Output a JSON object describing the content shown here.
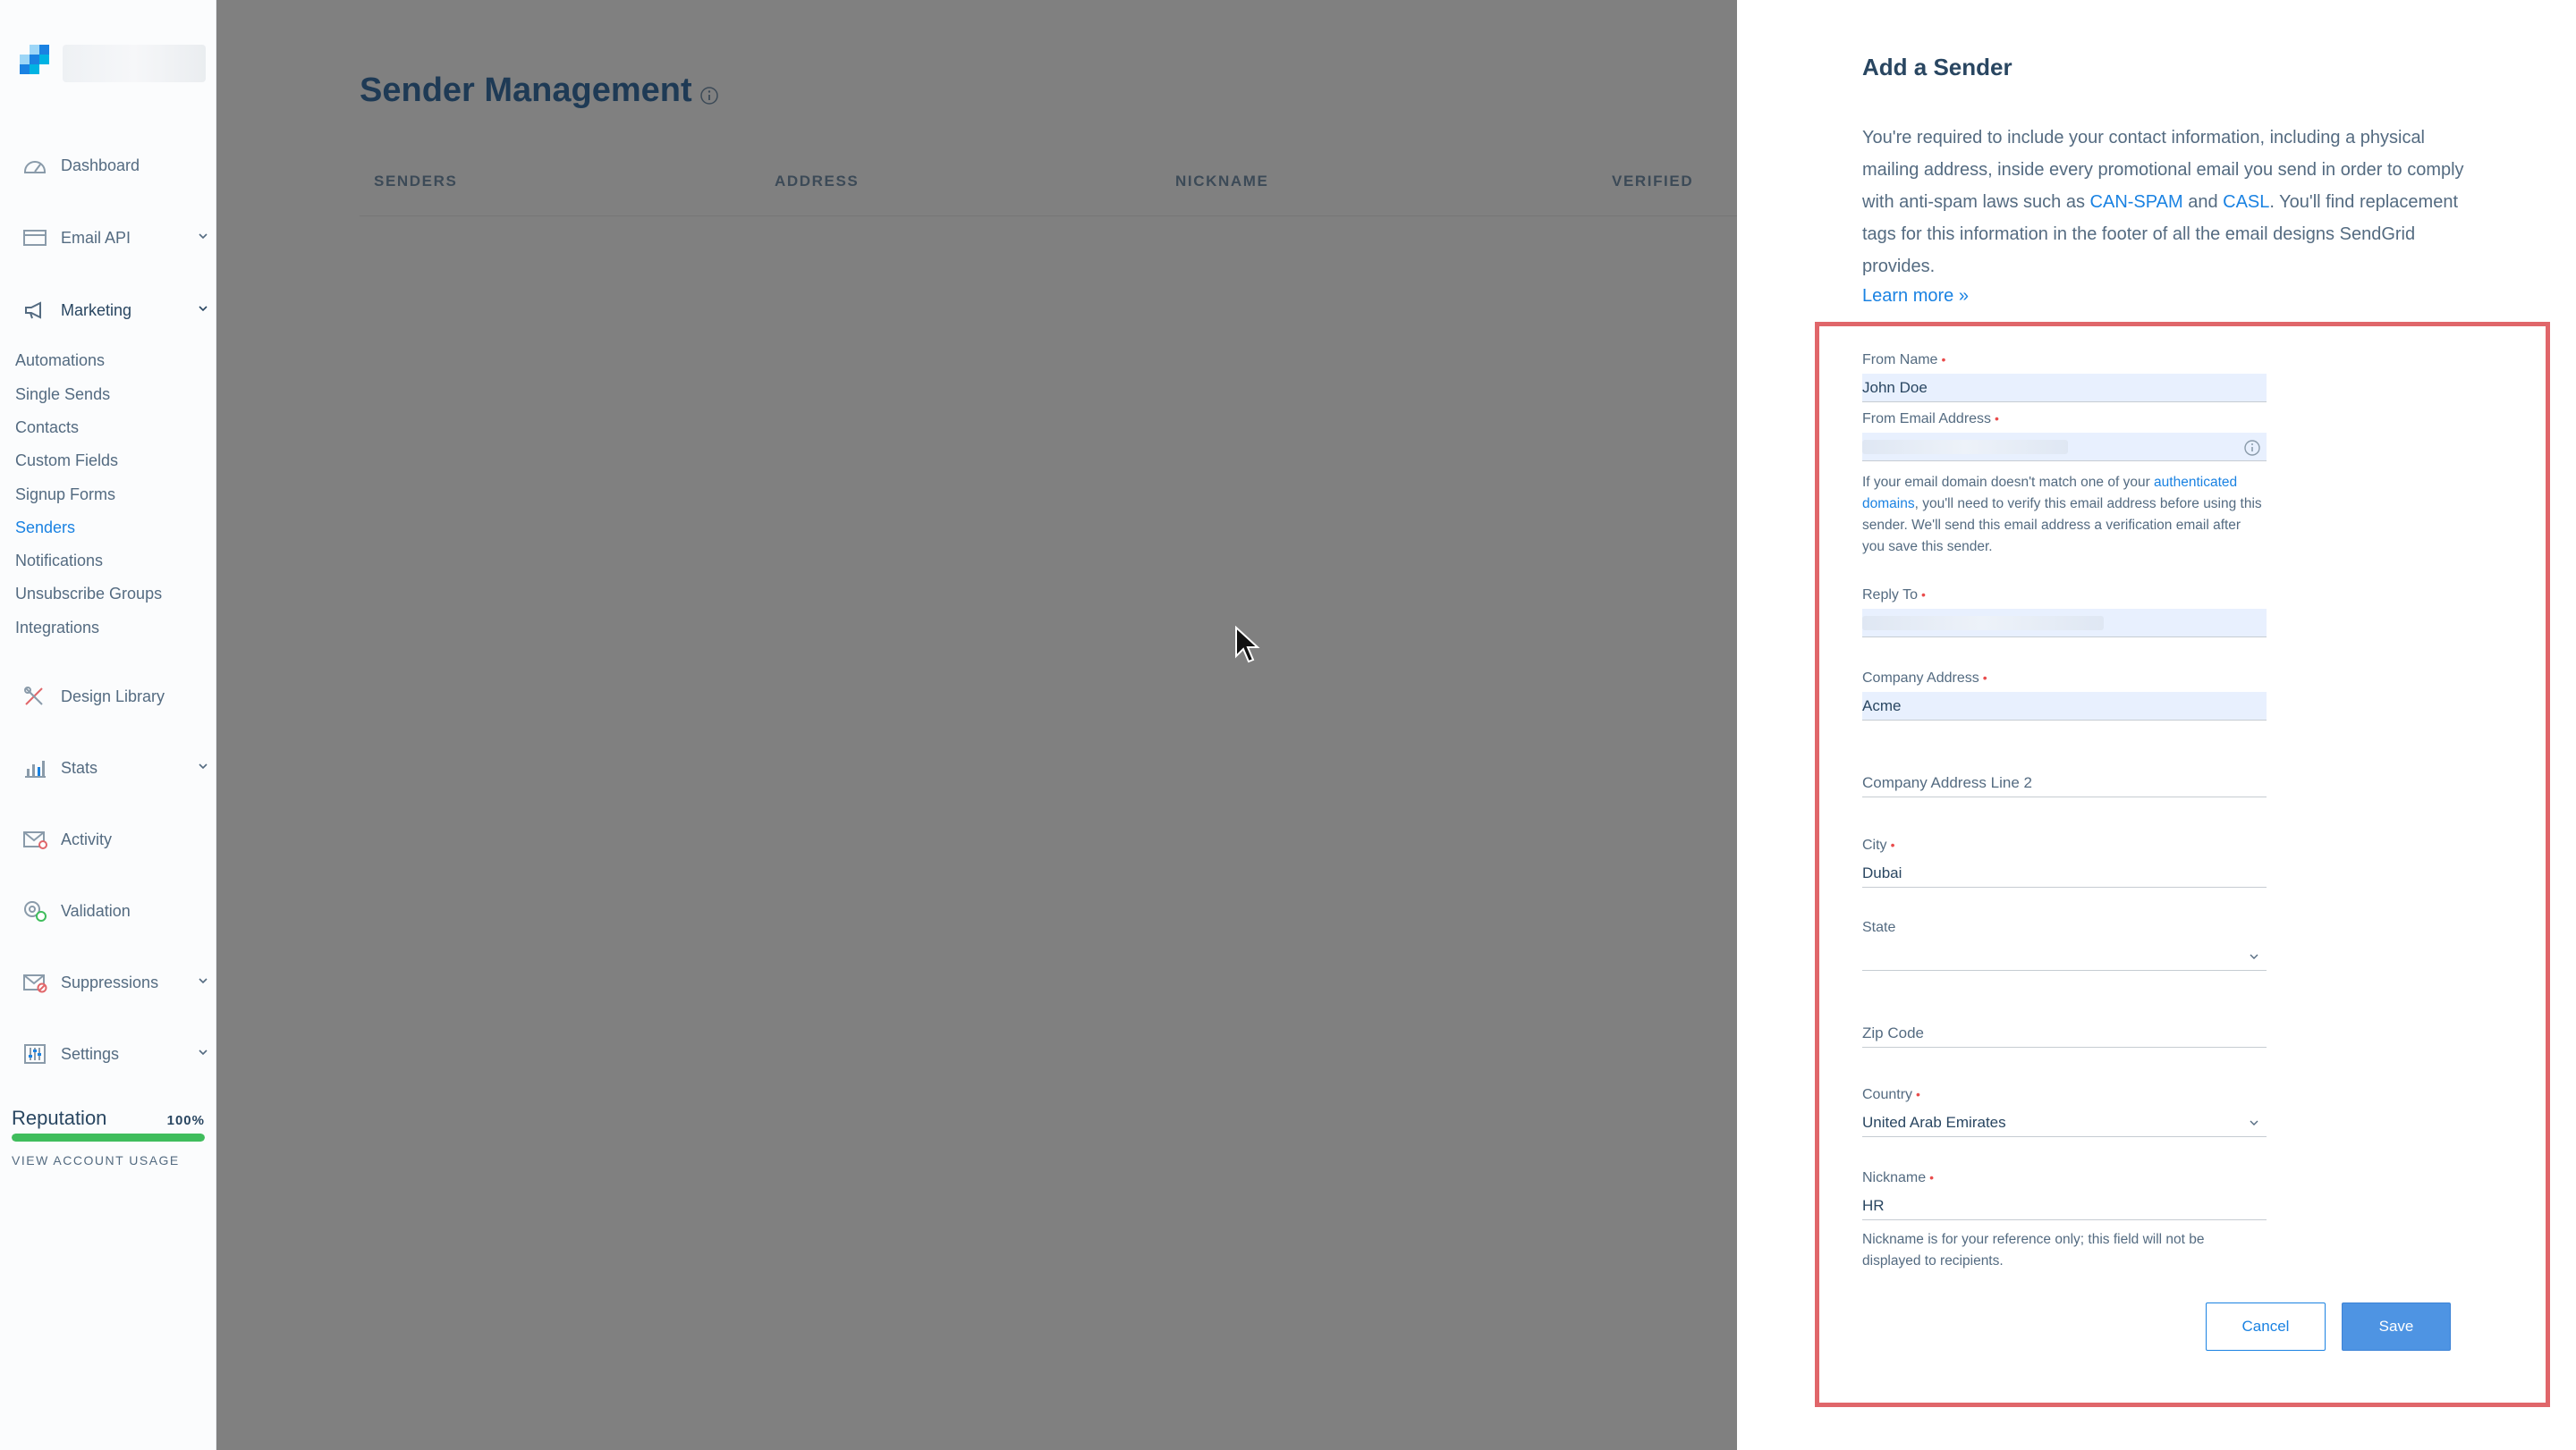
{
  "sidebar": {
    "items": [
      {
        "label": "Dashboard",
        "icon": "dashboard-icon"
      },
      {
        "label": "Email API",
        "icon": "email-api-icon"
      },
      {
        "label": "Marketing",
        "icon": "megaphone-icon"
      },
      {
        "label": "Design Library",
        "icon": "design-library-icon"
      },
      {
        "label": "Stats",
        "icon": "stats-icon"
      },
      {
        "label": "Activity",
        "icon": "activity-icon"
      },
      {
        "label": "Validation",
        "icon": "validation-icon"
      },
      {
        "label": "Suppressions",
        "icon": "suppressions-icon"
      },
      {
        "label": "Settings",
        "icon": "settings-icon"
      }
    ],
    "marketing_sub": [
      "Automations",
      "Single Sends",
      "Contacts",
      "Custom Fields",
      "Signup Forms",
      "Senders",
      "Notifications",
      "Unsubscribe Groups",
      "Integrations"
    ],
    "selected_sub": "Senders",
    "reputation_label": "Reputation",
    "reputation_value": "100%",
    "reputation_fraction": 1.0,
    "account_usage": "VIEW ACCOUNT USAGE"
  },
  "main": {
    "title": "Sender Management",
    "columns": [
      "SENDERS",
      "ADDRESS",
      "NICKNAME",
      "VERIFIED"
    ]
  },
  "panel": {
    "title": "Add a Sender",
    "intro_1": "You're required to include your contact information, including a physical mailing address, inside every promotional email you send in order to comply with anti-spam laws such as ",
    "link_canspam": "CAN-SPAM",
    "intro_and": " and ",
    "link_casl": "CASL",
    "intro_2": ". You'll find replacement tags for this information in the footer of all the email designs SendGrid provides.",
    "learn_more": "Learn more »",
    "fields": {
      "from_name": {
        "label": "From Name",
        "value": "John Doe"
      },
      "from_email": {
        "label": "From Email Address",
        "value": ""
      },
      "from_email_help_1": "If your email domain doesn't match one of your ",
      "from_email_help_link": "authenticated domains",
      "from_email_help_2": ", you'll need to verify this email address before using this sender. We'll send this email address a verification email after you save this sender.",
      "reply_to": {
        "label": "Reply To",
        "value": ""
      },
      "company_address": {
        "label": "Company Address",
        "value": "Acme"
      },
      "company_address_2": {
        "label": "Company Address Line 2",
        "value": ""
      },
      "city": {
        "label": "City",
        "value": "Dubai"
      },
      "state": {
        "label": "State",
        "value": ""
      },
      "zip": {
        "label": "Zip Code",
        "value": ""
      },
      "country": {
        "label": "Country",
        "value": "United Arab Emirates"
      },
      "nickname": {
        "label": "Nickname",
        "value": "HR"
      },
      "nickname_help": "Nickname is for your reference only; this field will not be displayed to recipients."
    },
    "required_mark": "•",
    "cancel_label": "Cancel",
    "save_label": "Save"
  },
  "colors": {
    "accent": "#1a82e2",
    "overlay": "#808080",
    "highlight": "#e0666a",
    "reputation": "#3fbd5c",
    "required": "#e94c4c"
  }
}
